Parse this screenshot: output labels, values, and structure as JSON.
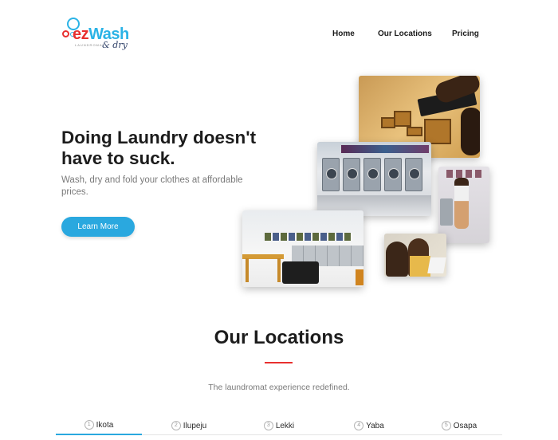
{
  "brand": {
    "name_prefix": "ez",
    "name_suffix": "Wash",
    "tagline": "LAUNDROMAT",
    "script": "& dry",
    "accent_blue": "#2aa8df",
    "accent_red": "#e8302f"
  },
  "nav": {
    "items": [
      {
        "label": "Home"
      },
      {
        "label": "Our Locations"
      },
      {
        "label": "Pricing"
      }
    ]
  },
  "hero": {
    "title": "Doing Laundry doesn't have to suck.",
    "subtitle": "Wash, dry and fold your clothes at affordable prices.",
    "cta_label": "Learn More"
  },
  "locations": {
    "title": "Our Locations",
    "subtitle": "The laundromat experience redefined.",
    "tabs": [
      {
        "num": "1",
        "label": "Ikota",
        "active": true
      },
      {
        "num": "2",
        "label": "Ilupeju",
        "active": false
      },
      {
        "num": "3",
        "label": "Lekki",
        "active": false
      },
      {
        "num": "4",
        "label": "Yaba",
        "active": false
      },
      {
        "num": "5",
        "label": "Osapa",
        "active": false
      }
    ]
  }
}
